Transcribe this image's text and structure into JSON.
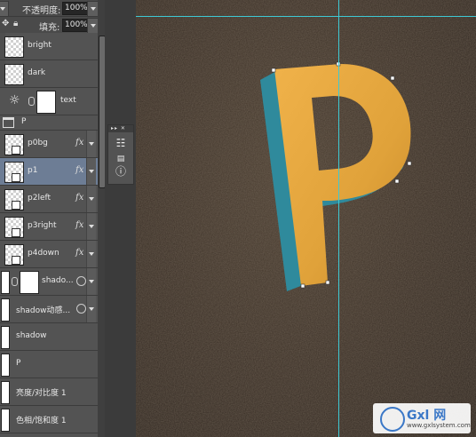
{
  "top": {
    "opacity_label": "不透明度:",
    "opacity_value": "100%",
    "fill_label": "填充:",
    "fill_value": "100%"
  },
  "layers": [
    {
      "name": "bright"
    },
    {
      "name": "dark"
    },
    {
      "name": "text"
    },
    {
      "name": "P",
      "group": true
    },
    {
      "name": "p0bg",
      "fx": "fx"
    },
    {
      "name": "p1",
      "fx": "fx",
      "selected": true
    },
    {
      "name": "p2left",
      "fx": "fx"
    },
    {
      "name": "p3right",
      "fx": "fx"
    },
    {
      "name": "p4down",
      "fx": "fx"
    },
    {
      "name": "shado..."
    },
    {
      "name": "shadow动感..."
    },
    {
      "name": "shadow"
    },
    {
      "name": "P"
    },
    {
      "name": "亮度/对比度 1"
    },
    {
      "name": "色相/饱和度 1"
    }
  ],
  "canvas": {
    "letter": "P",
    "face_color": "#e0a23a",
    "side_color": "#2f8a9c",
    "guide_color": "#3ec9d4"
  },
  "watermark": {
    "brand": "Gxl 网",
    "url": "www.gxlsystem.com"
  }
}
